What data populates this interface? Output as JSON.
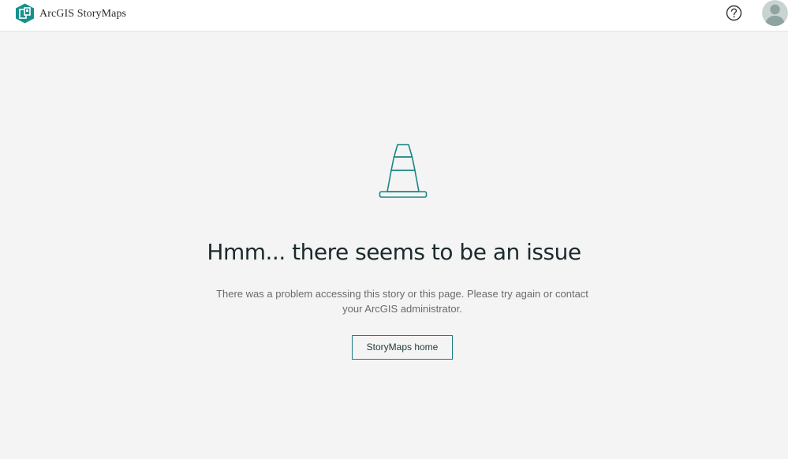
{
  "header": {
    "brand_name": "ArcGIS StoryMaps",
    "logo_icon": "storymaps-logo-icon",
    "help_icon": "help-circle-icon",
    "avatar_icon": "user-avatar-icon"
  },
  "error": {
    "illustration_icon": "traffic-cone-icon",
    "title": "Hmm... there seems to be an issue",
    "message": "There was a problem accessing this story or this page. Please try again or contact your ArcGIS administrator.",
    "home_button_label": "StoryMaps home"
  },
  "colors": {
    "accent": "#167e80",
    "page_background": "#f4f4f4",
    "header_background": "#ffffff"
  }
}
